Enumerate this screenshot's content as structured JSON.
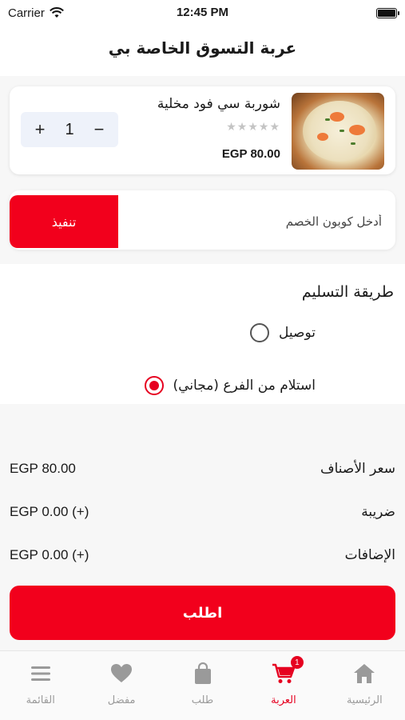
{
  "status_bar": {
    "carrier": "Carrier",
    "time": "12:45 PM"
  },
  "header": {
    "title": "عربة التسوق الخاصة بي"
  },
  "cart_item": {
    "name": "شوربة سي فود مخلية",
    "rating": 0,
    "stars": "★★★★★",
    "price": "EGP 80.00",
    "quantity": "1",
    "plus": "+",
    "minus": "−"
  },
  "coupon": {
    "placeholder": "أدخل كوبون الخصم",
    "apply_label": "تنفيذ"
  },
  "delivery": {
    "title": "طريقة التسليم",
    "options": [
      {
        "label": "توصيل",
        "selected": false
      },
      {
        "label": "استلام من الفرع  (مجاني)",
        "selected": true
      }
    ]
  },
  "summary": {
    "rows": [
      {
        "label": "سعر الأصناف",
        "value": "EGP 80.00"
      },
      {
        "label": "ضريبة",
        "value": "EGP 0.00 (+)"
      },
      {
        "label": "الإضافات",
        "value": "EGP 0.00 (+)"
      }
    ]
  },
  "order_button": {
    "label": "اطلب"
  },
  "tab_bar": {
    "tabs": [
      {
        "label": "القائمة",
        "icon": "menu-icon",
        "active": false
      },
      {
        "label": "مفضل",
        "icon": "heart-icon",
        "active": false
      },
      {
        "label": "طلب",
        "icon": "bag-icon",
        "active": false
      },
      {
        "label": "العربة",
        "icon": "cart-icon",
        "active": true,
        "badge": "1"
      },
      {
        "label": "الرئيسية",
        "icon": "home-icon",
        "active": false
      }
    ]
  },
  "colors": {
    "accent": "#f2001c",
    "inactive": "#9a9a9a"
  }
}
